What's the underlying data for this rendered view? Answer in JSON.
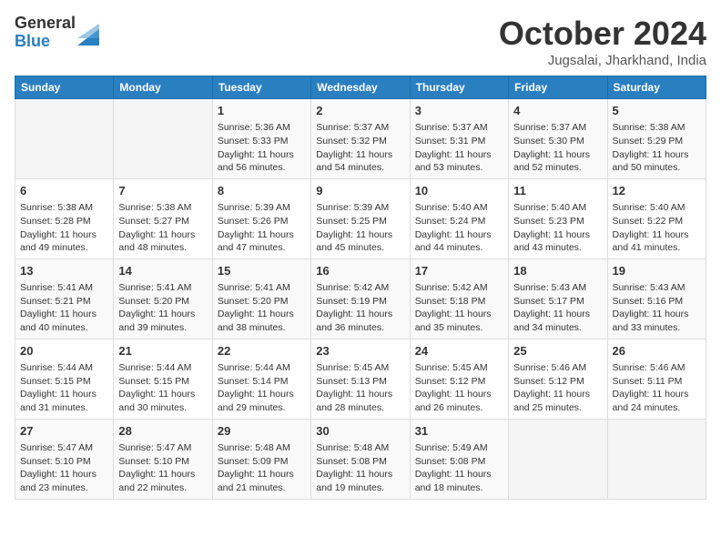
{
  "logo": {
    "general": "General",
    "blue": "Blue"
  },
  "title": "October 2024",
  "location": "Jugsalai, Jharkhand, India",
  "weekdays": [
    "Sunday",
    "Monday",
    "Tuesday",
    "Wednesday",
    "Thursday",
    "Friday",
    "Saturday"
  ],
  "weeks": [
    [
      {
        "day": "",
        "data": ""
      },
      {
        "day": "",
        "data": ""
      },
      {
        "day": "1",
        "sunrise": "Sunrise: 5:36 AM",
        "sunset": "Sunset: 5:33 PM",
        "daylight": "Daylight: 11 hours and 56 minutes."
      },
      {
        "day": "2",
        "sunrise": "Sunrise: 5:37 AM",
        "sunset": "Sunset: 5:32 PM",
        "daylight": "Daylight: 11 hours and 54 minutes."
      },
      {
        "day": "3",
        "sunrise": "Sunrise: 5:37 AM",
        "sunset": "Sunset: 5:31 PM",
        "daylight": "Daylight: 11 hours and 53 minutes."
      },
      {
        "day": "4",
        "sunrise": "Sunrise: 5:37 AM",
        "sunset": "Sunset: 5:30 PM",
        "daylight": "Daylight: 11 hours and 52 minutes."
      },
      {
        "day": "5",
        "sunrise": "Sunrise: 5:38 AM",
        "sunset": "Sunset: 5:29 PM",
        "daylight": "Daylight: 11 hours and 50 minutes."
      }
    ],
    [
      {
        "day": "6",
        "sunrise": "Sunrise: 5:38 AM",
        "sunset": "Sunset: 5:28 PM",
        "daylight": "Daylight: 11 hours and 49 minutes."
      },
      {
        "day": "7",
        "sunrise": "Sunrise: 5:38 AM",
        "sunset": "Sunset: 5:27 PM",
        "daylight": "Daylight: 11 hours and 48 minutes."
      },
      {
        "day": "8",
        "sunrise": "Sunrise: 5:39 AM",
        "sunset": "Sunset: 5:26 PM",
        "daylight": "Daylight: 11 hours and 47 minutes."
      },
      {
        "day": "9",
        "sunrise": "Sunrise: 5:39 AM",
        "sunset": "Sunset: 5:25 PM",
        "daylight": "Daylight: 11 hours and 45 minutes."
      },
      {
        "day": "10",
        "sunrise": "Sunrise: 5:40 AM",
        "sunset": "Sunset: 5:24 PM",
        "daylight": "Daylight: 11 hours and 44 minutes."
      },
      {
        "day": "11",
        "sunrise": "Sunrise: 5:40 AM",
        "sunset": "Sunset: 5:23 PM",
        "daylight": "Daylight: 11 hours and 43 minutes."
      },
      {
        "day": "12",
        "sunrise": "Sunrise: 5:40 AM",
        "sunset": "Sunset: 5:22 PM",
        "daylight": "Daylight: 11 hours and 41 minutes."
      }
    ],
    [
      {
        "day": "13",
        "sunrise": "Sunrise: 5:41 AM",
        "sunset": "Sunset: 5:21 PM",
        "daylight": "Daylight: 11 hours and 40 minutes."
      },
      {
        "day": "14",
        "sunrise": "Sunrise: 5:41 AM",
        "sunset": "Sunset: 5:20 PM",
        "daylight": "Daylight: 11 hours and 39 minutes."
      },
      {
        "day": "15",
        "sunrise": "Sunrise: 5:41 AM",
        "sunset": "Sunset: 5:20 PM",
        "daylight": "Daylight: 11 hours and 38 minutes."
      },
      {
        "day": "16",
        "sunrise": "Sunrise: 5:42 AM",
        "sunset": "Sunset: 5:19 PM",
        "daylight": "Daylight: 11 hours and 36 minutes."
      },
      {
        "day": "17",
        "sunrise": "Sunrise: 5:42 AM",
        "sunset": "Sunset: 5:18 PM",
        "daylight": "Daylight: 11 hours and 35 minutes."
      },
      {
        "day": "18",
        "sunrise": "Sunrise: 5:43 AM",
        "sunset": "Sunset: 5:17 PM",
        "daylight": "Daylight: 11 hours and 34 minutes."
      },
      {
        "day": "19",
        "sunrise": "Sunrise: 5:43 AM",
        "sunset": "Sunset: 5:16 PM",
        "daylight": "Daylight: 11 hours and 33 minutes."
      }
    ],
    [
      {
        "day": "20",
        "sunrise": "Sunrise: 5:44 AM",
        "sunset": "Sunset: 5:15 PM",
        "daylight": "Daylight: 11 hours and 31 minutes."
      },
      {
        "day": "21",
        "sunrise": "Sunrise: 5:44 AM",
        "sunset": "Sunset: 5:15 PM",
        "daylight": "Daylight: 11 hours and 30 minutes."
      },
      {
        "day": "22",
        "sunrise": "Sunrise: 5:44 AM",
        "sunset": "Sunset: 5:14 PM",
        "daylight": "Daylight: 11 hours and 29 minutes."
      },
      {
        "day": "23",
        "sunrise": "Sunrise: 5:45 AM",
        "sunset": "Sunset: 5:13 PM",
        "daylight": "Daylight: 11 hours and 28 minutes."
      },
      {
        "day": "24",
        "sunrise": "Sunrise: 5:45 AM",
        "sunset": "Sunset: 5:12 PM",
        "daylight": "Daylight: 11 hours and 26 minutes."
      },
      {
        "day": "25",
        "sunrise": "Sunrise: 5:46 AM",
        "sunset": "Sunset: 5:12 PM",
        "daylight": "Daylight: 11 hours and 25 minutes."
      },
      {
        "day": "26",
        "sunrise": "Sunrise: 5:46 AM",
        "sunset": "Sunset: 5:11 PM",
        "daylight": "Daylight: 11 hours and 24 minutes."
      }
    ],
    [
      {
        "day": "27",
        "sunrise": "Sunrise: 5:47 AM",
        "sunset": "Sunset: 5:10 PM",
        "daylight": "Daylight: 11 hours and 23 minutes."
      },
      {
        "day": "28",
        "sunrise": "Sunrise: 5:47 AM",
        "sunset": "Sunset: 5:10 PM",
        "daylight": "Daylight: 11 hours and 22 minutes."
      },
      {
        "day": "29",
        "sunrise": "Sunrise: 5:48 AM",
        "sunset": "Sunset: 5:09 PM",
        "daylight": "Daylight: 11 hours and 21 minutes."
      },
      {
        "day": "30",
        "sunrise": "Sunrise: 5:48 AM",
        "sunset": "Sunset: 5:08 PM",
        "daylight": "Daylight: 11 hours and 19 minutes."
      },
      {
        "day": "31",
        "sunrise": "Sunrise: 5:49 AM",
        "sunset": "Sunset: 5:08 PM",
        "daylight": "Daylight: 11 hours and 18 minutes."
      },
      {
        "day": "",
        "data": ""
      },
      {
        "day": "",
        "data": ""
      }
    ]
  ]
}
